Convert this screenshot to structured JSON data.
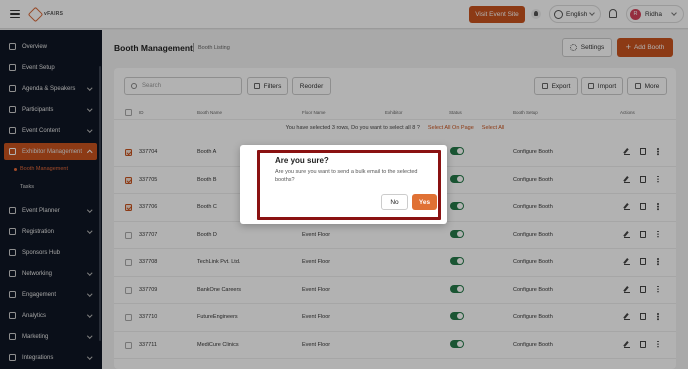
{
  "header": {
    "logo_text": "vFAIRS",
    "visit_event_site": "Visit Event Site",
    "language": "English",
    "user_initial": "R",
    "user_name": "Ridha"
  },
  "sidebar": {
    "items": [
      {
        "label": "Overview"
      },
      {
        "label": "Event Setup"
      },
      {
        "label": "Agenda & Speakers"
      },
      {
        "label": "Participants"
      },
      {
        "label": "Event Content"
      },
      {
        "label": "Exhibitor Management"
      },
      {
        "label": "Event Planner"
      },
      {
        "label": "Registration"
      },
      {
        "label": "Sponsors Hub"
      },
      {
        "label": "Networking"
      },
      {
        "label": "Engagement"
      },
      {
        "label": "Analytics"
      },
      {
        "label": "Marketing"
      },
      {
        "label": "Integrations"
      }
    ],
    "sub_items": [
      {
        "label": "Booth Management"
      },
      {
        "label": "Tasks"
      }
    ]
  },
  "page": {
    "title": "Booth Management",
    "breadcrumb": "Booth Listing",
    "settings_label": "Settings",
    "add_label": "Add Booth"
  },
  "toolbar": {
    "search_placeholder": "Search",
    "filters": "Filters",
    "reorder": "Reorder",
    "export": "Export",
    "import": "Import",
    "more": "More"
  },
  "table": {
    "columns": {
      "id": "ID",
      "booth_name": "Booth Name",
      "floor_name": "Floor Name",
      "exhibitor": "Exhibitor",
      "status": "Status",
      "booth_setup": "Booth Setup",
      "actions": "Actions"
    },
    "notice": "You have selected 3 rows, Do you want to select all 8 ?",
    "select_page": "Select All On Page",
    "select_all": "Select All",
    "rows": [
      {
        "id": "337704",
        "name": "Booth A",
        "floor": "",
        "setup": "Configure Booth",
        "checked": true
      },
      {
        "id": "337705",
        "name": "Booth B",
        "floor": "",
        "setup": "Configure Booth",
        "checked": true
      },
      {
        "id": "337706",
        "name": "Booth C",
        "floor": "",
        "setup": "Configure Booth",
        "checked": true
      },
      {
        "id": "337707",
        "name": "Booth D",
        "floor": "Event Floor",
        "setup": "Configure Booth",
        "checked": false
      },
      {
        "id": "337708",
        "name": "TechLink Pvt. Ltd.",
        "floor": "Event Floor",
        "setup": "Configure Booth",
        "checked": false
      },
      {
        "id": "337709",
        "name": "BankOne Careers",
        "floor": "Event Floor",
        "setup": "Configure Booth",
        "checked": false
      },
      {
        "id": "337710",
        "name": "FutureEngineers",
        "floor": "Event Floor",
        "setup": "Configure Booth",
        "checked": false
      },
      {
        "id": "337711",
        "name": "MediCure Clinics",
        "floor": "Event Floor",
        "setup": "Configure Booth",
        "checked": false
      }
    ]
  },
  "dialog": {
    "title": "Are you sure?",
    "message": "Are you sure you want to send a bulk email to the selected booths?",
    "no": "No",
    "yes": "Yes"
  },
  "colors": {
    "accent": "#c9541f",
    "sidebar_bg": "#0f1624",
    "toggle_on": "#267a4a",
    "highlight": "#8a1111"
  }
}
